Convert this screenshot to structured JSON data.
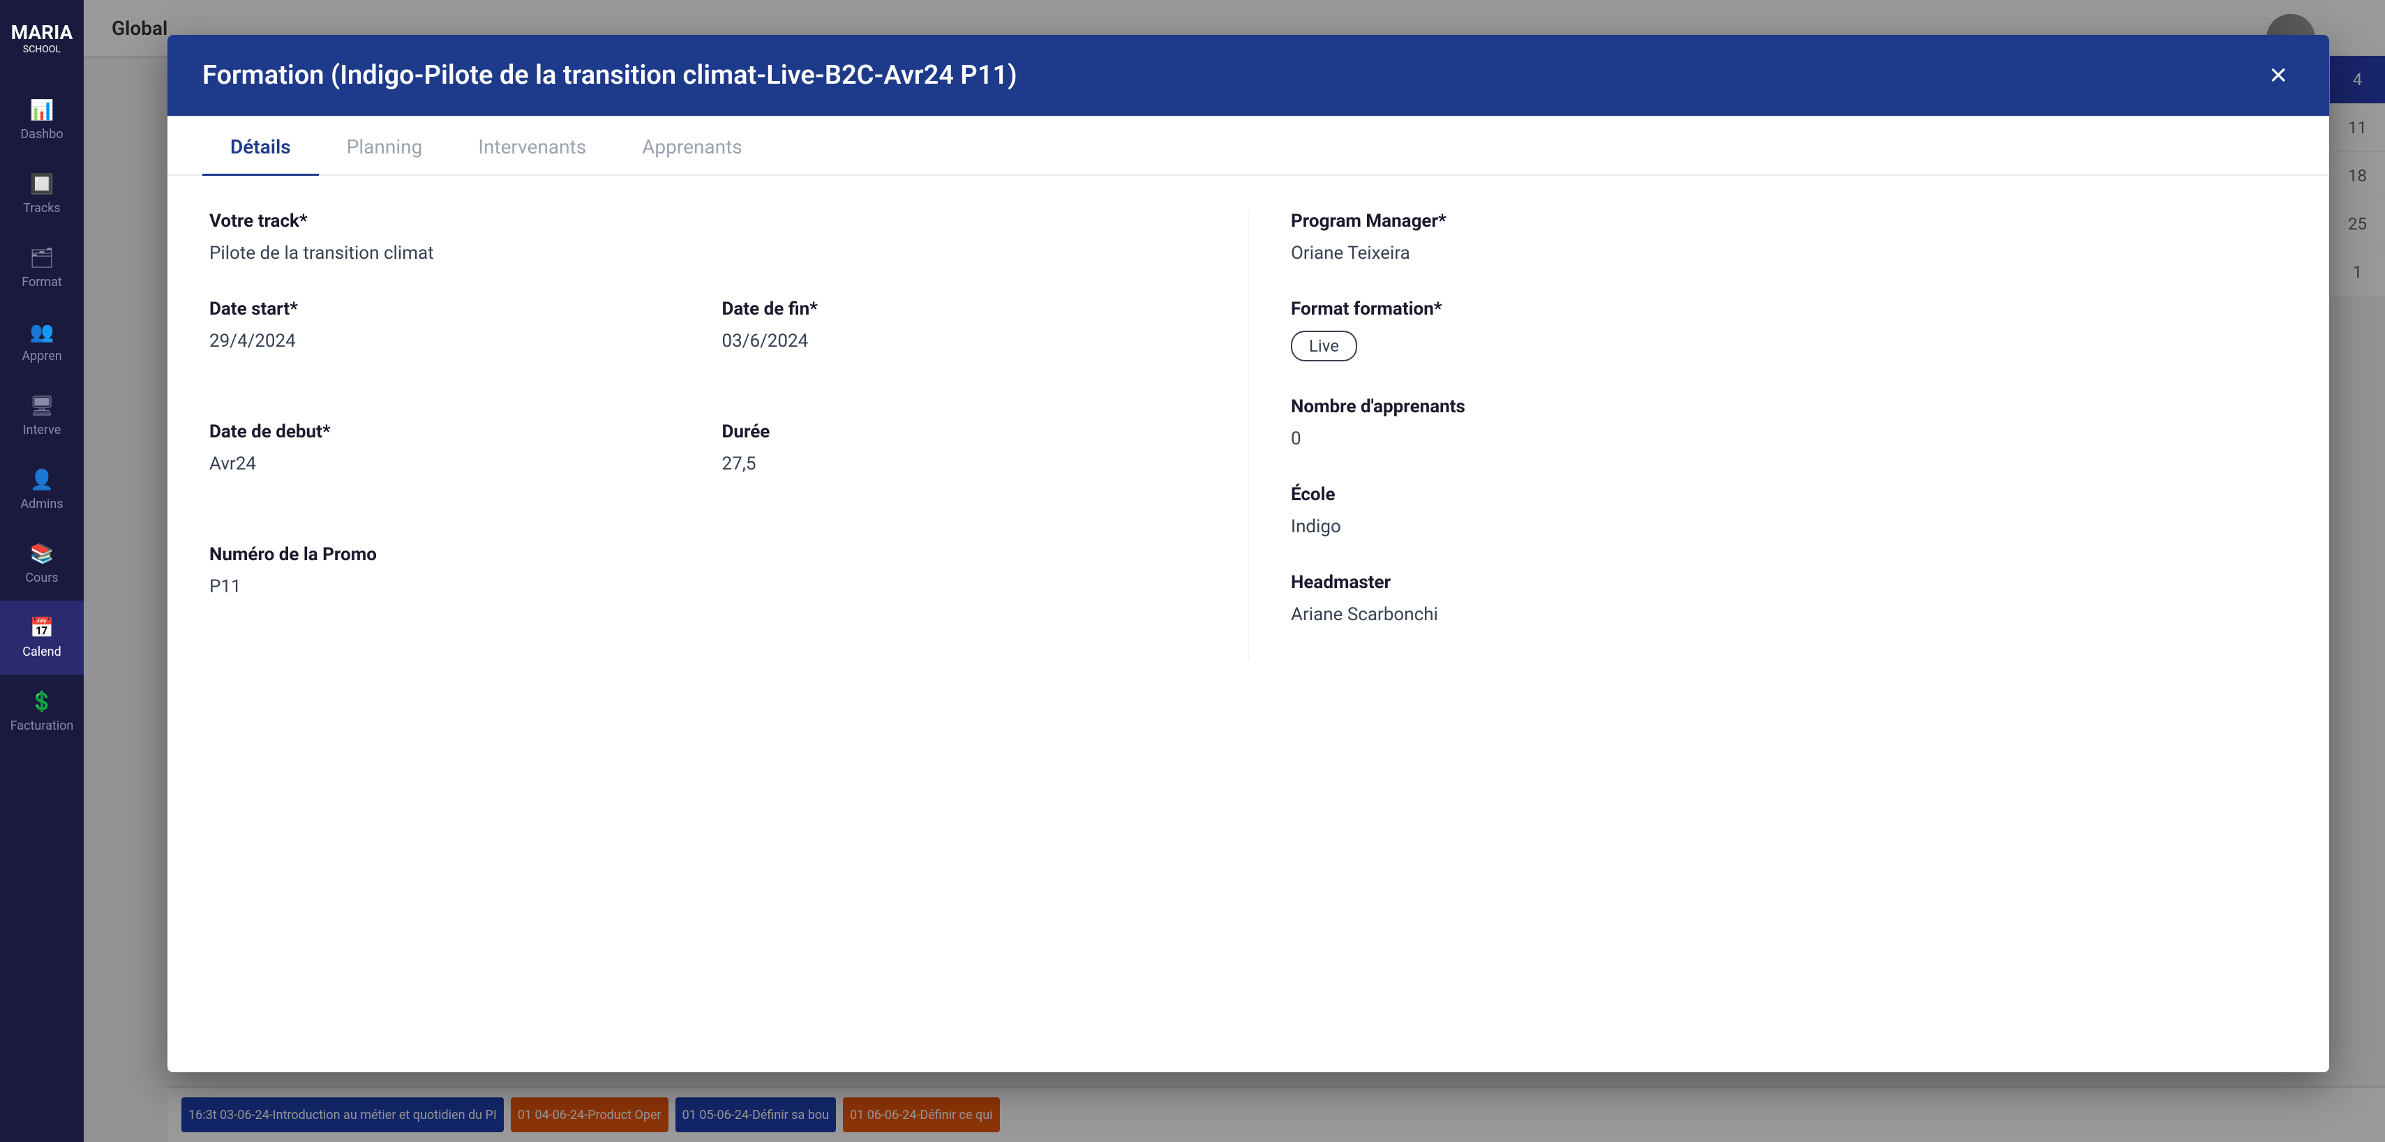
{
  "sidebar": {
    "logo": "MARIA",
    "logo_sub": "SCHOOL",
    "items": [
      {
        "id": "dashboard",
        "icon": "📊",
        "label": "Dashbo"
      },
      {
        "id": "tracks",
        "icon": "🔲",
        "label": "Tracks"
      },
      {
        "id": "format",
        "icon": "🗂",
        "label": "Format"
      },
      {
        "id": "appren",
        "icon": "👥",
        "label": "Appren"
      },
      {
        "id": "interv",
        "icon": "🖥",
        "label": "Interve"
      },
      {
        "id": "admin",
        "icon": "👤",
        "label": "Admins"
      },
      {
        "id": "cours",
        "icon": "📚",
        "label": "Cours"
      },
      {
        "id": "calendar",
        "icon": "📅",
        "label": "Calend",
        "active": true
      },
      {
        "id": "facturation",
        "icon": "💲",
        "label": "Facturation"
      }
    ]
  },
  "topbar": {
    "title": "Global"
  },
  "numberBadges": [
    {
      "value": "4",
      "highlight": true
    },
    {
      "value": "11"
    },
    {
      "value": "18"
    },
    {
      "value": "25"
    },
    {
      "value": "1"
    }
  ],
  "modal": {
    "title": "Formation (Indigo-Pilote de la transition climat-Live-B2C-Avr24 P11)",
    "close_label": "×",
    "tabs": [
      {
        "id": "details",
        "label": "Détails",
        "active": true
      },
      {
        "id": "planning",
        "label": "Planning"
      },
      {
        "id": "intervenants",
        "label": "Intervenants"
      },
      {
        "id": "apprenants",
        "label": "Apprenants"
      }
    ],
    "details": {
      "votre_track_label": "Votre track*",
      "votre_track_value": "Pilote de la transition climat",
      "program_manager_label": "Program Manager*",
      "program_manager_value": "Oriane Teixeira",
      "date_start_label": "Date start*",
      "date_start_value": "29/4/2024",
      "date_fin_label": "Date de fin*",
      "date_fin_value": "03/6/2024",
      "format_formation_label": "Format formation*",
      "format_formation_value": "Live",
      "date_debut_label": "Date de debut*",
      "date_debut_value": "Avr24",
      "duree_label": "Durée",
      "duree_value": "27,5",
      "nombre_apprenants_label": "Nombre d'apprenants",
      "nombre_apprenants_value": "0",
      "numero_promo_label": "Numéro de la Promo",
      "numero_promo_value": "P11",
      "ecole_label": "École",
      "ecole_value": "Indigo",
      "headmaster_label": "Headmaster",
      "headmaster_value": "Ariane Scarbonchi"
    }
  },
  "calendarEvents": [
    {
      "label": "16:3t 03-06-24-Introduction au métier et quotidien du PI",
      "color": "blue"
    },
    {
      "label": "01 04-06-24-Product Oper",
      "color": "orange"
    },
    {
      "label": "01 05-06-24-Définir sa bou",
      "color": "blue"
    },
    {
      "label": "01 06-06-24-Définir ce qui",
      "color": "orange"
    }
  ]
}
